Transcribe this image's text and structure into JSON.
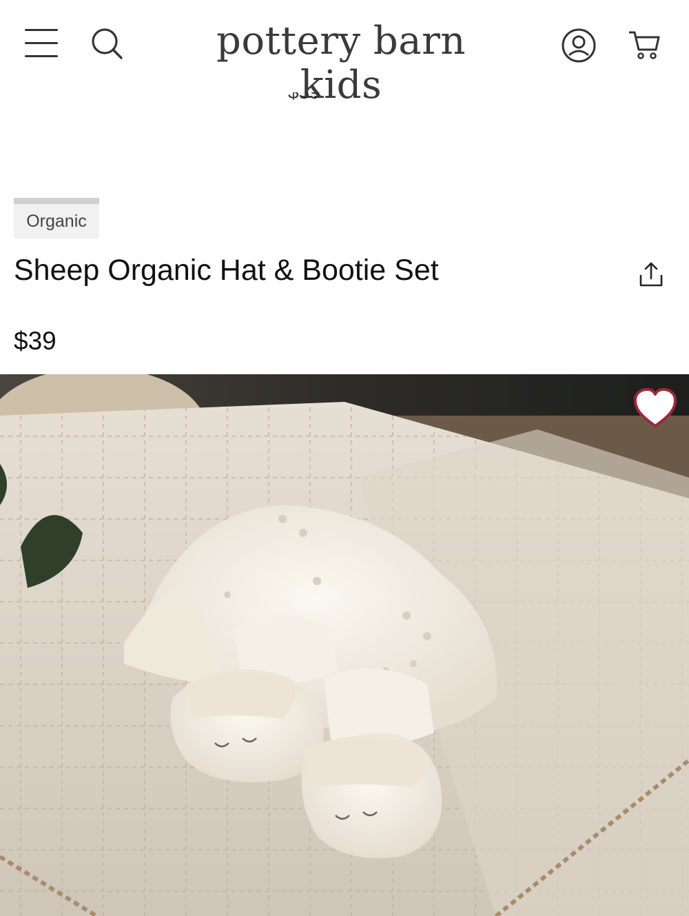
{
  "header": {
    "logo_text": "pottery barn kids",
    "menu_icon": "hamburger-menu-icon",
    "search_icon": "search-icon",
    "account_icon": "user-account-icon",
    "cart_icon": "shopping-cart-icon"
  },
  "peek_price": "$39",
  "product": {
    "badge": "Organic",
    "title": "Sheep Organic Hat & Bootie Set",
    "price": "$39",
    "share_icon": "share-icon",
    "favorite_icon": "heart-icon"
  },
  "colors": {
    "text": "#111111",
    "badge_bg": "#f1f1f1",
    "badge_bar": "#cfcfcf",
    "heart_outline": "#a0283a"
  }
}
